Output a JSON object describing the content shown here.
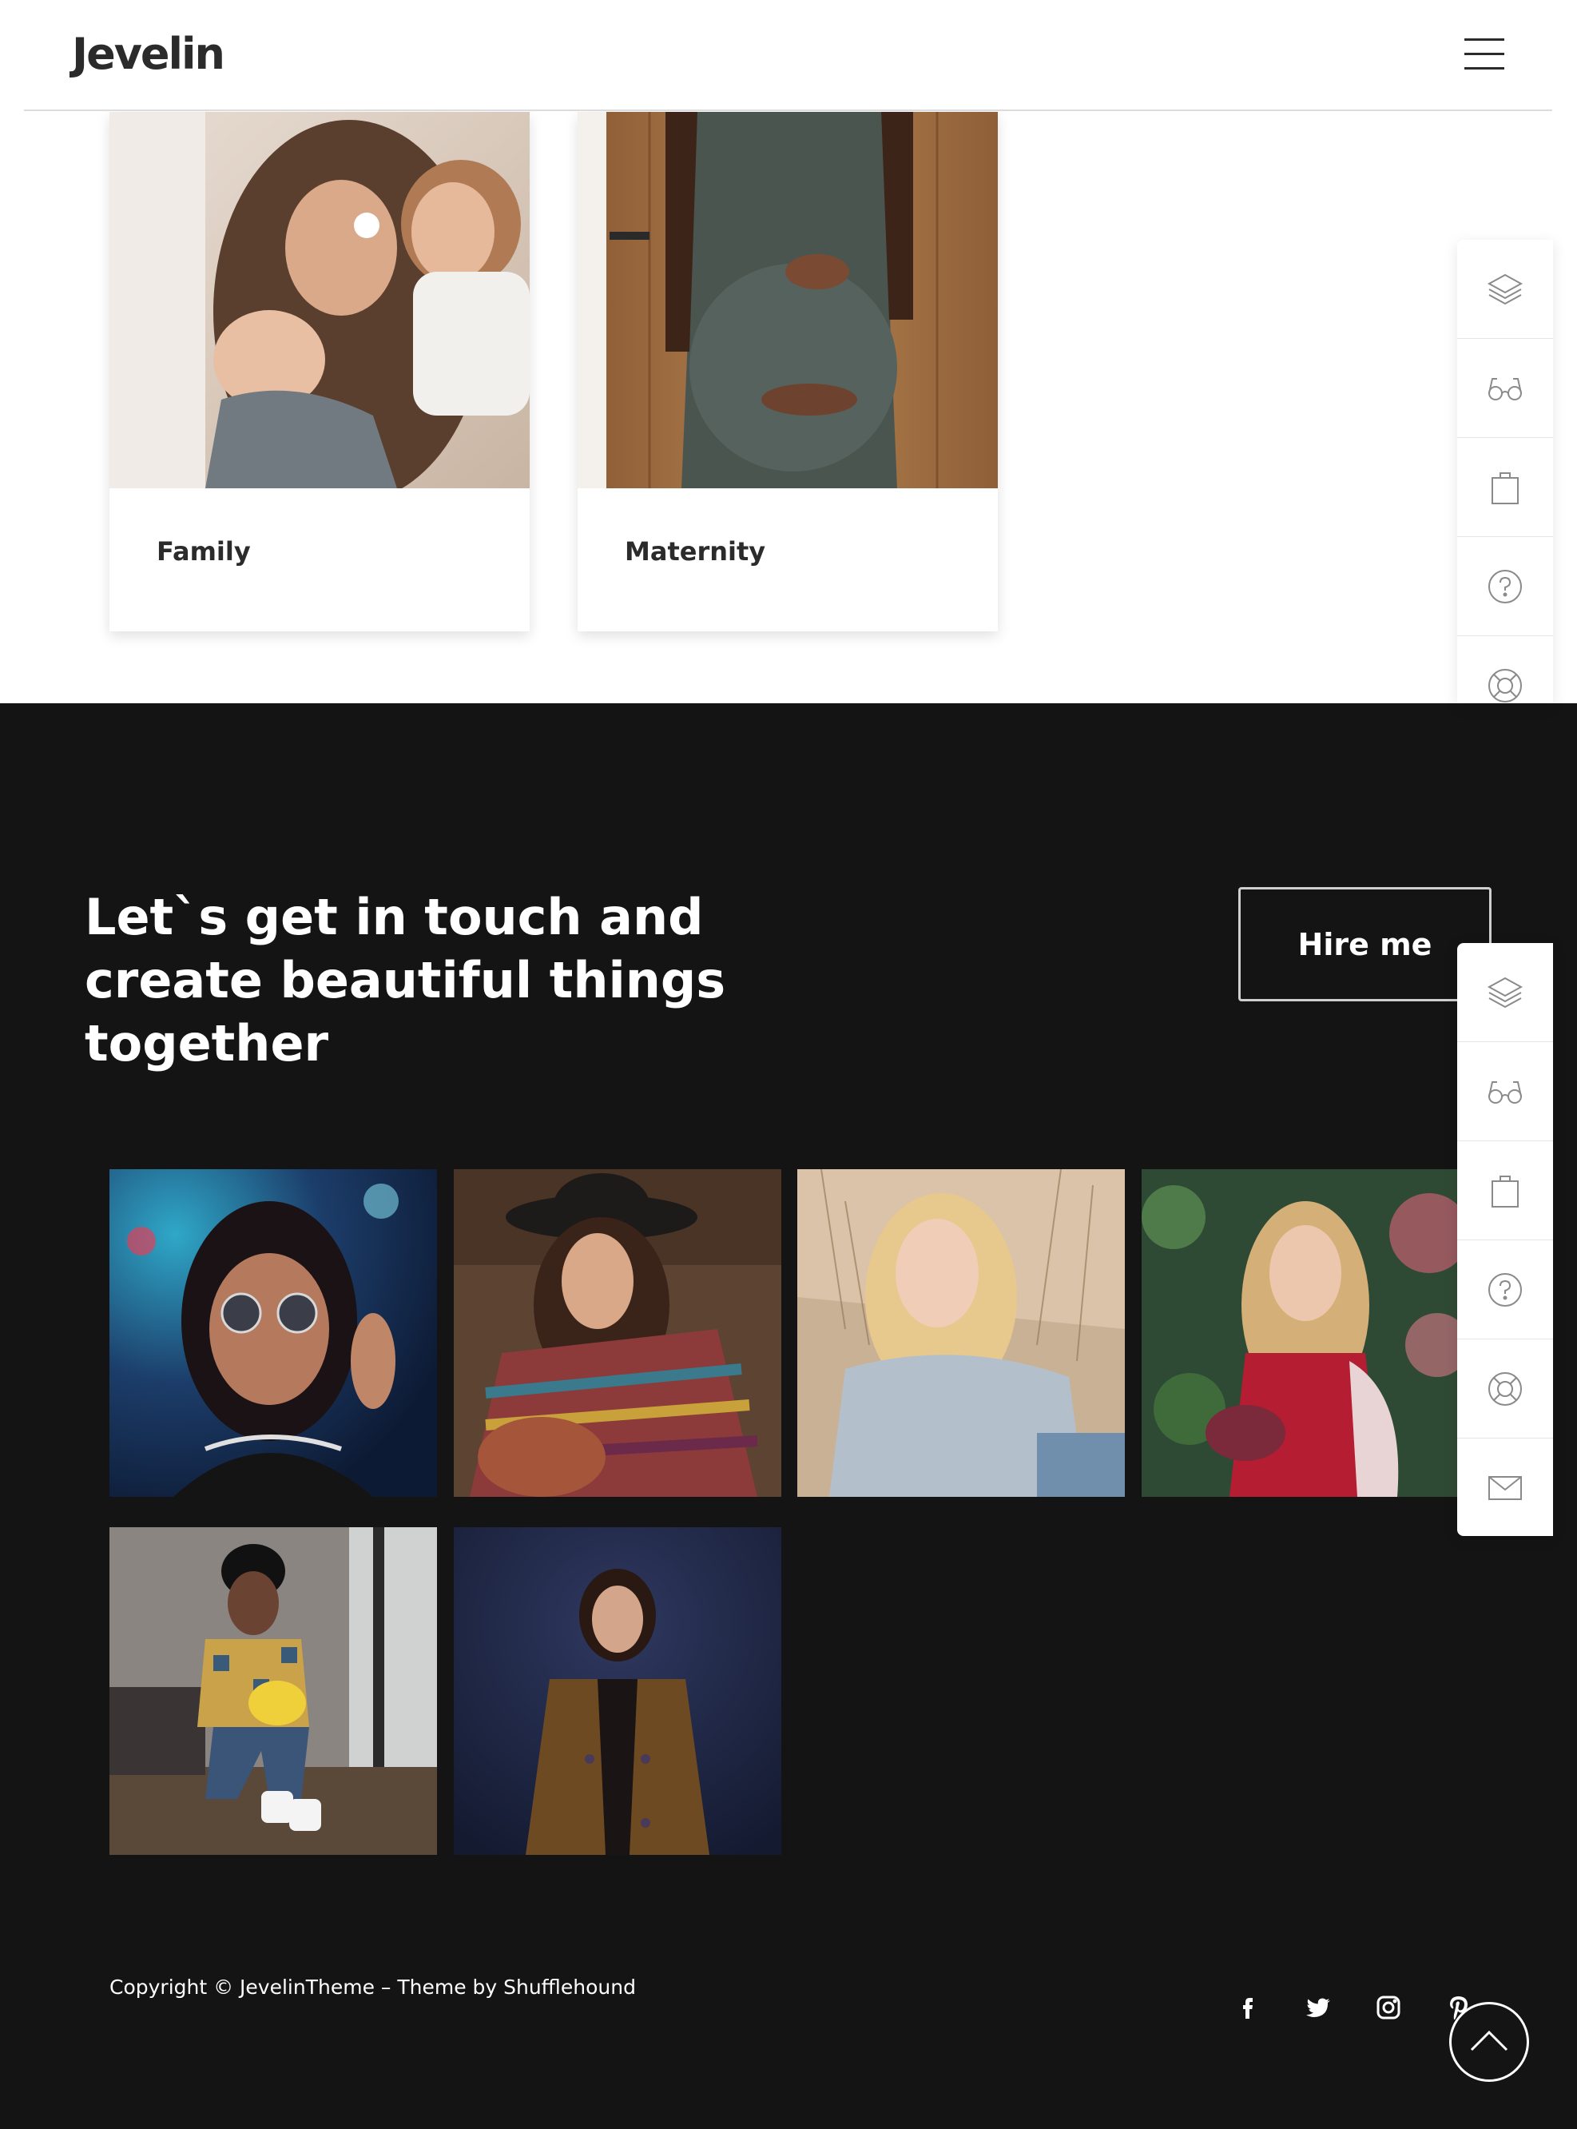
{
  "header": {
    "logo": "Jevelin",
    "menu_icon": "hamburger-menu-icon"
  },
  "categories": [
    {
      "title": "Family"
    },
    {
      "title": "Maternity"
    }
  ],
  "side_toolbar_icons": [
    "layers-icon",
    "glasses-icon",
    "shopping-bag-icon",
    "help-circle-icon",
    "lifebuoy-icon",
    "mail-icon"
  ],
  "contact": {
    "headline": "Let`s get in touch and create beautiful things together",
    "hire_button": "Hire me"
  },
  "gallery": [
    {
      "icon": "portrait-sunglasses-photo"
    },
    {
      "icon": "portrait-hat-photo"
    },
    {
      "icon": "portrait-blonde-photo"
    },
    {
      "icon": "portrait-red-dress-photo"
    },
    {
      "icon": "portrait-street-style-photo"
    },
    {
      "icon": "portrait-coat-photo"
    }
  ],
  "footer": {
    "copyright": "Copyright © JevelinTheme – Theme by Shufflehound",
    "social": [
      "facebook-icon",
      "twitter-icon",
      "instagram-icon",
      "pinterest-icon"
    ],
    "back_to_top_icon": "chevron-up-icon"
  },
  "colors": {
    "dark_bg": "#141415",
    "text_dark": "#2b2b2b",
    "white": "#ffffff"
  }
}
